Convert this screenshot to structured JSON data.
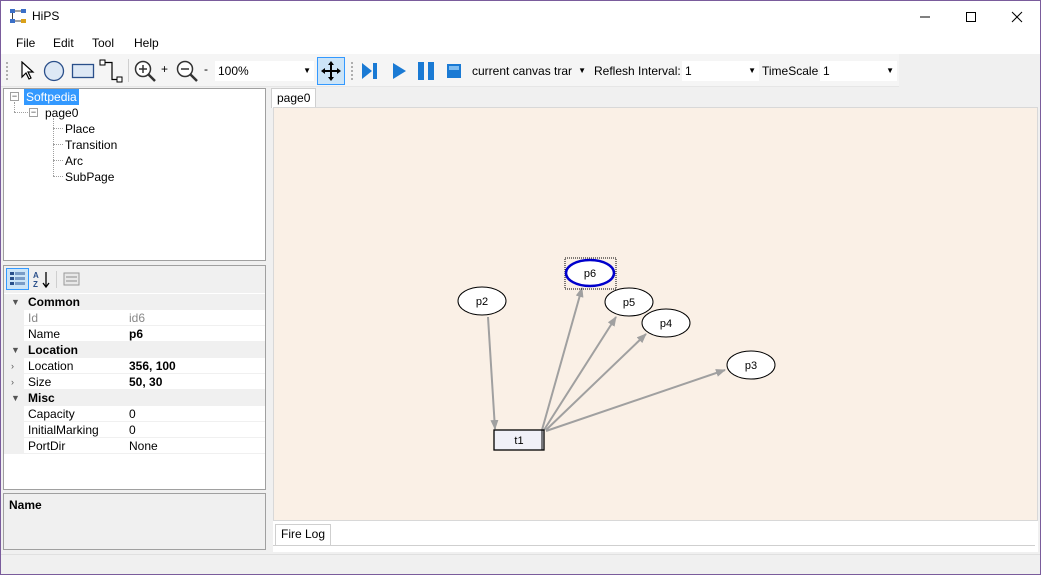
{
  "window": {
    "title": "HiPS"
  },
  "menu": {
    "file": "File",
    "edit": "Edit",
    "tool": "Tool",
    "help": "Help"
  },
  "toolbar": {
    "zoom_plus": "+",
    "zoom_minus": "-",
    "zoom_value": "100%",
    "canvas_mode": "current canvas trar",
    "interval_label": "Reflesh Interval:",
    "interval_value": "1",
    "timescale_label": "TimeScale",
    "timescale_value": "1"
  },
  "tree": {
    "root": "Softpedia",
    "page": "page0",
    "items": [
      "Place",
      "Transition",
      "Arc",
      "SubPage"
    ]
  },
  "properties": {
    "categories": {
      "common": "Common",
      "location": "Location",
      "misc": "Misc"
    },
    "rows": {
      "id": {
        "name": "Id",
        "value": "id6"
      },
      "name": {
        "name": "Name",
        "value": "p6"
      },
      "location": {
        "name": "Location",
        "value": "356, 100"
      },
      "size": {
        "name": "Size",
        "value": "50, 30"
      },
      "capacity": {
        "name": "Capacity",
        "value": "0"
      },
      "marking": {
        "name": "InitialMarking",
        "value": "0"
      },
      "portdir": {
        "name": "PortDir",
        "value": "None"
      }
    },
    "description_title": "Name"
  },
  "document": {
    "tab": "page0",
    "log_tab": "Fire Log"
  },
  "net": {
    "places": [
      "p6",
      "p2",
      "p5",
      "p4",
      "p3"
    ],
    "transition": "t1",
    "selected_color": "#0000cc",
    "arc_color": "#a0a0a0"
  }
}
